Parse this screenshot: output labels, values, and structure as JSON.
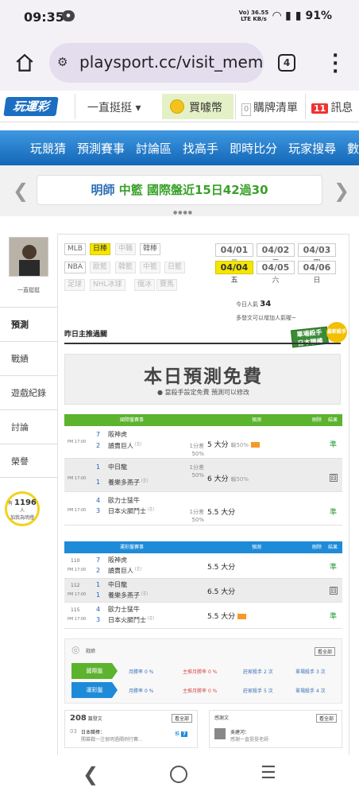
{
  "status": {
    "time": "09:35",
    "net_top": "Vo) 36.55",
    "net_bottom": "LTE KB/s",
    "battery": "91%"
  },
  "browser": {
    "url": "playsport.cc/visit_mem",
    "tab_count": "4"
  },
  "site": {
    "logo": "玩運彩",
    "user": "一直挺挺",
    "coin_label": "買噱幣",
    "cart_count": "0",
    "cart_label": "購牌清單",
    "msg_count": "11",
    "msg_label": "訊息"
  },
  "nav": [
    "玩競猜",
    "預測賽事",
    "討論區",
    "找高手",
    "即時比分",
    "玩家搜尋",
    "數據"
  ],
  "marquee": {
    "name": "明師",
    "league": "中籃",
    "text": "國際盤近15日42過30"
  },
  "sidebar": {
    "username": "一直挺挺",
    "items": [
      "預測",
      "戰績",
      "遊戲紀錄",
      "討論",
      "榮譽"
    ],
    "fans_prefix": "有",
    "fans_count": "1196",
    "fans_suffix": "人",
    "fans_note": "加我為明燈"
  },
  "leagues": {
    "row1": [
      "MLB",
      "日棒",
      "中職",
      "韓棒"
    ],
    "row2": [
      "NBA",
      "歐籃",
      "韓籃",
      "中籃",
      "日籃"
    ],
    "row3": [
      "足球",
      "NHL冰球",
      "俄冰",
      "賽馬"
    ]
  },
  "dates": [
    {
      "d": "04/01",
      "w": "二"
    },
    {
      "d": "04/02",
      "w": "三"
    },
    {
      "d": "04/03",
      "w": "四"
    },
    {
      "d": "04/04",
      "w": "五"
    },
    {
      "d": "04/05",
      "w": "六"
    },
    {
      "d": "04/06",
      "w": "日"
    }
  ],
  "popularity": {
    "label": "今日人氣",
    "value": "34",
    "note": "多發文可以增加人氣喔~"
  },
  "badge": {
    "title": "單場殺手",
    "sub": "日本職棒",
    "seal": "最新殺手"
  },
  "section_title": "昨日主推過關",
  "free": {
    "headline": "本日預測免費",
    "note": "當殺手設定免費 預測可以修改"
  },
  "intl": {
    "head": [
      "國際盤賽事",
      "預測",
      "刪除",
      "結果"
    ],
    "rows": [
      {
        "time": "PM 17:00",
        "n1": "7",
        "t1": "阪神虎",
        "n2": "2",
        "t2": "讀賣巨人",
        "hc1": "1分差",
        "hc2": "50%",
        "pick": "5 大分",
        "extra": "輸50%",
        "result": "準"
      },
      {
        "time": "PM 17:00",
        "n1": "1",
        "t1": "中日龍",
        "n2": "1",
        "t2": "養樂多燕子",
        "hc1": "1分差",
        "hc2": "50%",
        "pick": "6 大分",
        "extra": "輸50%",
        "result": "囧"
      },
      {
        "time": "PM 17:00",
        "n1": "4",
        "t1": "歐力士猛牛",
        "n2": "3",
        "t2": "日本火腿鬥士",
        "hc1": "1分差",
        "hc2": "50%",
        "pick": "5.5 大分",
        "extra": "",
        "result": "準"
      }
    ]
  },
  "lottery": {
    "head": [
      "運彩盤賽事",
      "預測",
      "刪除",
      "結果"
    ],
    "rows": [
      {
        "gid": "110",
        "time": "PM 17:00",
        "n1": "7",
        "t1": "阪神虎",
        "n2": "2",
        "t2": "讀賣巨人",
        "pick": "5.5 大分",
        "result": "準"
      },
      {
        "gid": "112",
        "time": "PM 17:00",
        "n1": "1",
        "t1": "中日龍",
        "n2": "1",
        "t2": "養樂多燕子",
        "pick": "6.5 大分",
        "result": "囧"
      },
      {
        "gid": "115",
        "time": "PM 17:00",
        "n1": "4",
        "t1": "歐力士猛牛",
        "n2": "3",
        "t2": "日本火腿鬥士",
        "pick": "5.5 大分",
        "result": "準"
      }
    ]
  },
  "stats": {
    "head": "戰績",
    "more": "看全部",
    "rows": [
      {
        "label": "國際盤",
        "c1": "月勝率",
        "v1": "0",
        "c2": "主推月勝率",
        "v2": "0",
        "c3": "莊家殺手",
        "v3": "2",
        "c4": "單場殺手",
        "v4": "3"
      },
      {
        "label": "運彩盤",
        "c1": "月勝率",
        "v1": "0",
        "c2": "主推月勝率",
        "v2": "0",
        "c3": "莊家殺手",
        "v3": "5",
        "c4": "單場殺手",
        "v4": "4"
      }
    ]
  },
  "cards": {
    "left": {
      "count": "208",
      "label": "篇發文",
      "more": "看全部",
      "date": "03",
      "title": "日本職棒：",
      "preview": "開幕戰一注很明過關例行賽...",
      "tag": "推",
      "tagnum": "7"
    },
    "right": {
      "label": "感謝文",
      "more": "看全部",
      "title": "吳建河：",
      "preview": "感謝一直挺挺老師"
    }
  },
  "colors": {
    "nav_blue": "#1c6ec2",
    "intl_green": "#5cb32e",
    "lottery_blue": "#1e8bd8",
    "win_green": "#2b9a36"
  }
}
